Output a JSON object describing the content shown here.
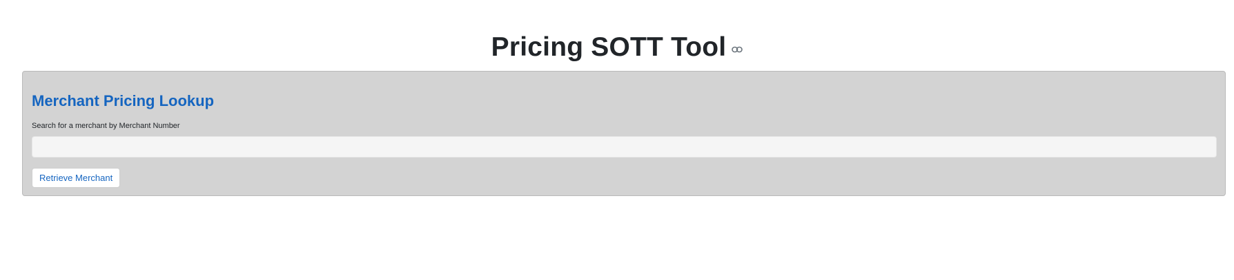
{
  "header": {
    "title": "Pricing SOTT Tool",
    "anchor_icon": "link-icon"
  },
  "lookup": {
    "heading": "Merchant Pricing Lookup",
    "search_label": "Search for a merchant by Merchant Number",
    "search_value": "",
    "search_placeholder": "",
    "retrieve_label": "Retrieve Merchant"
  },
  "colors": {
    "accent": "#1565c0",
    "panel_background": "#d3d3d3",
    "title_text": "#212529"
  }
}
